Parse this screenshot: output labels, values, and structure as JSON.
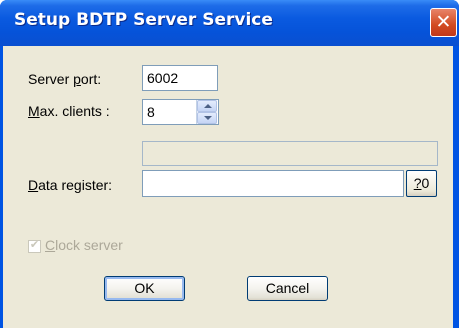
{
  "window": {
    "title": "Setup BDTP Server Service",
    "close_glyph": "✕"
  },
  "form": {
    "server_port": {
      "label_pre": "Server ",
      "label_hotkey": "p",
      "label_post": "ort:",
      "value": "6002"
    },
    "max_clients": {
      "label_hotkey": "M",
      "label_post": "ax. clients :",
      "value": "8"
    },
    "data_register": {
      "label_hotkey": "D",
      "label_post": "ata register:",
      "value": "",
      "display_value": "",
      "browse_label_hotkey": "?",
      "browse_label_post": "0"
    },
    "clock_server": {
      "label_hotkey": "C",
      "label_post": "lock server",
      "checked": true,
      "enabled": false
    }
  },
  "buttons": {
    "ok": "OK",
    "cancel": "Cancel"
  },
  "icons": {
    "close": "close-icon",
    "spin_up": "chevron-up-icon",
    "spin_down": "chevron-down-icon",
    "check": "checkmark-icon"
  },
  "colors": {
    "titlebar": "#0054e3",
    "dialog_bg": "#ece9d8",
    "close_button": "#d24a20",
    "disabled_text": "#aca899"
  }
}
